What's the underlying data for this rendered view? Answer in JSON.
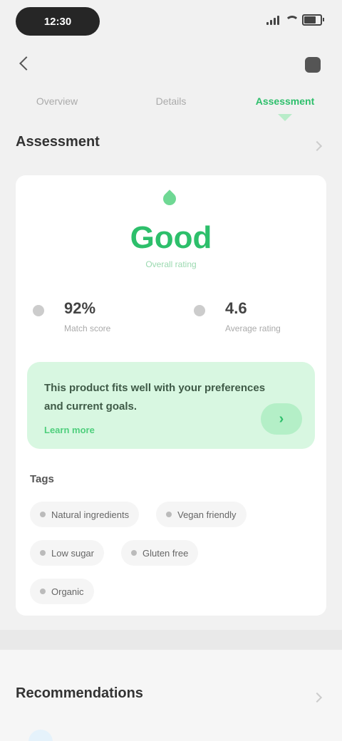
{
  "status_bar": {
    "time": "12:30",
    "battery_level": 0.8,
    "icons": [
      "signal-icon",
      "wifi-icon",
      "battery-icon"
    ]
  },
  "header": {
    "back_icon": "back-arrow-icon",
    "share_icon": "share-icon"
  },
  "tabs": [
    {
      "label": "Overview",
      "active": false
    },
    {
      "label": "Details",
      "active": false
    },
    {
      "label": "Assessment",
      "active": true
    }
  ],
  "assessment": {
    "section_title": "Assessment",
    "score_icon": "leaf-drop-icon",
    "score_value": "Good",
    "score_label": "Overall rating",
    "stats": [
      {
        "icon": "check-icon",
        "value": "92%",
        "label": "Match score"
      },
      {
        "icon": "star-icon",
        "value": "4.6",
        "label": "Average rating"
      }
    ],
    "tip": {
      "text": "This product fits well with your preferences and current goals.",
      "link": "Learn more",
      "button": "›"
    },
    "tags_title": "Tags",
    "tags": [
      [
        "Natural ingredients",
        "Vegan friendly"
      ],
      [
        "Low sugar",
        "Gluten free"
      ],
      [
        "Organic"
      ]
    ]
  },
  "recommendations": {
    "section_title": "Recommendations"
  },
  "colors": {
    "accent": "#2dbf6b",
    "accent_light": "#d8f7e1",
    "background": "#f1f1f1",
    "card": "#ffffff"
  }
}
